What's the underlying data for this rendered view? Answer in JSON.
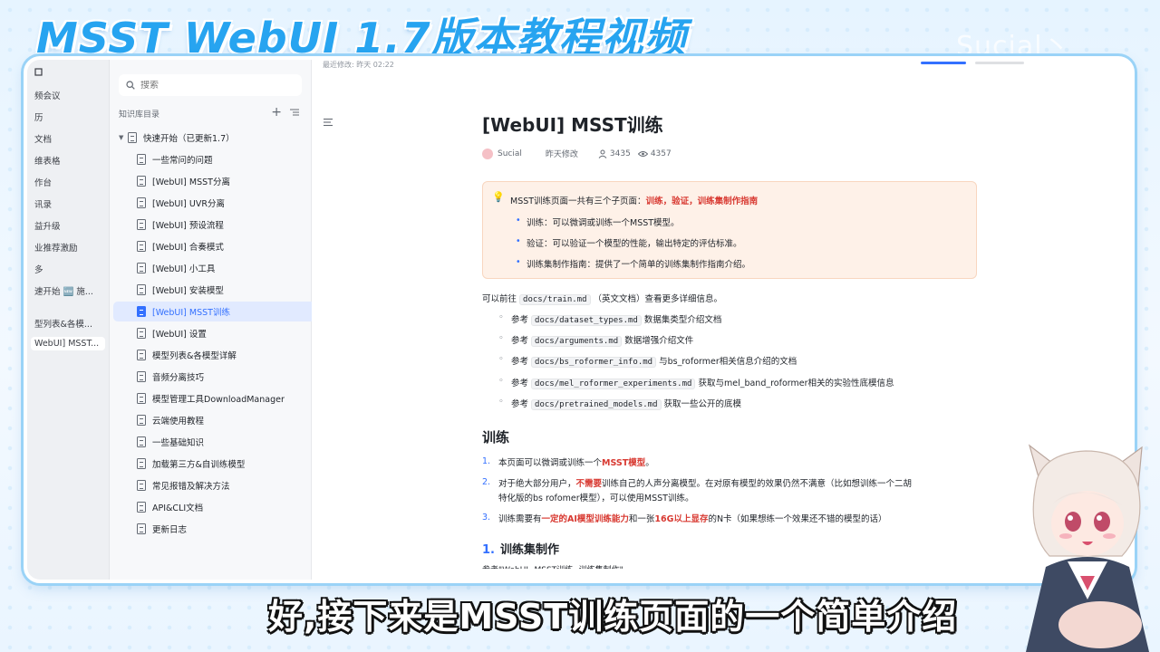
{
  "video": {
    "title": "MSST WebUI 1.7版本教程视频",
    "watermark": "Sucial丶",
    "subtitle": "好,接下来是MSST训练页面的一个简单介绍"
  },
  "app_nav": {
    "items": [
      {
        "label": "频会议"
      },
      {
        "label": "历"
      },
      {
        "label": "文档"
      },
      {
        "label": "维表格"
      },
      {
        "label": "作台"
      },
      {
        "label": "讯录"
      },
      {
        "label": "益升级"
      },
      {
        "label": "业推荐激励"
      },
      {
        "label": "多"
      },
      {
        "label": "速开始 🆕 施..."
      },
      {
        "label": "型列表&各模..."
      },
      {
        "label": "WebUI] MSST..."
      }
    ]
  },
  "sidebar": {
    "search_placeholder": "搜索",
    "kb_title": "知识库目录",
    "add_icon": "+",
    "tree": [
      {
        "label": "快速开始（已更新1.7）",
        "level": 0,
        "expanded": true
      },
      {
        "label": "一些常问的问题",
        "level": 1
      },
      {
        "label": "[WebUI] MSST分离",
        "level": 1
      },
      {
        "label": "[WebUI] UVR分离",
        "level": 1
      },
      {
        "label": "[WebUI] 预设流程",
        "level": 1
      },
      {
        "label": "[WebUI] 合奏模式",
        "level": 1
      },
      {
        "label": "[WebUI] 小工具",
        "level": 1
      },
      {
        "label": "[WebUI] 安装模型",
        "level": 1
      },
      {
        "label": "[WebUI] MSST训练",
        "level": 1,
        "active": true
      },
      {
        "label": "[WebUI] 设置",
        "level": 1
      },
      {
        "label": "模型列表&各模型详解",
        "level": 1
      },
      {
        "label": "音频分离技巧",
        "level": 1
      },
      {
        "label": "模型管理工具DownloadManager",
        "level": 1
      },
      {
        "label": "云端使用教程",
        "level": 1
      },
      {
        "label": "一些基础知识",
        "level": 1
      },
      {
        "label": "加载第三方&自训练模型",
        "level": 1
      },
      {
        "label": "常见报错及解决方法",
        "level": 1
      },
      {
        "label": "API&CLI文档",
        "level": 1
      },
      {
        "label": "更新日志",
        "level": 1
      }
    ]
  },
  "content": {
    "topline": "最近修改: 昨天 02:22",
    "title": "[WebUI] MSST训练",
    "author": "Sucial",
    "modified": "昨天修改",
    "likes": "3435",
    "views": "4357",
    "callout": {
      "lead": "MSST训练页面一共有三个子页面：",
      "lead_red": "训练，验证，训练集制作指南",
      "items": [
        "训练：可以微调或训练一个MSST模型。",
        "验证：可以验证一个模型的性能，输出特定的评估标准。",
        "训练集制作指南：提供了一个简单的训练集制作指南介绍。"
      ]
    },
    "intro": {
      "prefix": "可以前往",
      "code": "docs/train.md",
      "suffix": "（英文文档）查看更多详细信息。"
    },
    "refs": [
      {
        "prefix": "参考",
        "code": "docs/dataset_types.md",
        "suffix": "数据集类型介绍文档"
      },
      {
        "prefix": "参考",
        "code": "docs/arguments.md",
        "suffix": "数据增强介绍文件"
      },
      {
        "prefix": "参考",
        "code": "docs/bs_roformer_info.md",
        "suffix": "与bs_roformer相关信息介绍的文档"
      },
      {
        "prefix": "参考",
        "code": "docs/mel_roformer_experiments.md",
        "suffix": "获取与mel_band_roformer相关的实验性底模信息"
      },
      {
        "prefix": "参考",
        "code": "docs/pretrained_models.md",
        "suffix": "获取一些公开的底模"
      }
    ],
    "section_title": "训练",
    "numbered": [
      {
        "num": "1.",
        "a": "本页面可以微调或训练一个",
        "red": "MSST模型",
        "b": "。",
        "red2": "",
        "c": "",
        "line2": ""
      },
      {
        "num": "2.",
        "a": "对于绝大部分用户，",
        "red": "不需要",
        "b": "训练自己的人声分离模型。在对原有模型的效果仍然不满意（比如想训练一个二胡",
        "red2": "",
        "c": "",
        "line2": "特化版的bs rofomer模型），可以使用MSST训练。"
      },
      {
        "num": "3.",
        "a": "训练需要有",
        "red": "一定的AI模型训练能力",
        "b": "和一张",
        "red2": "16G以上显存",
        "c": "的N卡（如果想练一个效果还不错的模型的话）",
        "line2": ""
      }
    ],
    "subsection_num": "1.",
    "subsection_title": "训练集制作",
    "cut_text": "参考\"WebUI--MSST训练--训练集制作\""
  }
}
